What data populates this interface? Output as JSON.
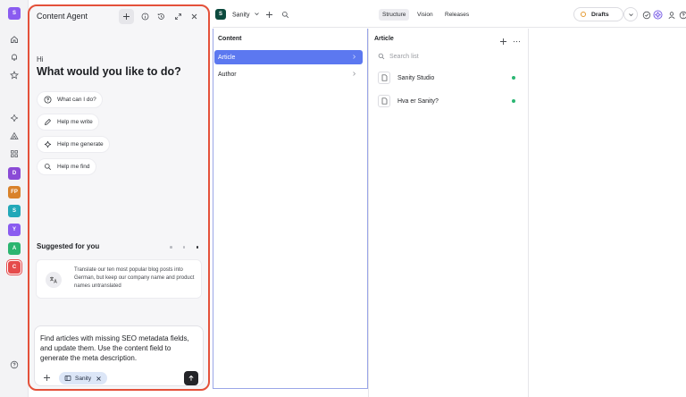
{
  "agent": {
    "title": "Content Agent",
    "greeting": "Hi",
    "headline": "What would you like to do?",
    "actions": [
      {
        "label": "What can I do?",
        "icon": "help-circle-icon"
      },
      {
        "label": "Help me write",
        "icon": "pencil-icon"
      },
      {
        "label": "Help me generate",
        "icon": "sparkle-icon"
      },
      {
        "label": "Help me find",
        "icon": "search-icon"
      }
    ],
    "suggested_title": "Suggested for you",
    "suggestion": "Translate our ten most popular blog posts into German, but keep our company name and product names untranslated",
    "input_text": "Find articles with missing SEO metadata fields, and update them. Use the content field to generate the meta description.",
    "context_pill": "Sanity"
  },
  "rail": {
    "workspace_initial": "S",
    "workspaces": [
      {
        "label": "D",
        "color": "#8a4bd6"
      },
      {
        "label": "FP",
        "color": "#d9822b"
      },
      {
        "label": "S",
        "color": "#23a8b8"
      },
      {
        "label": "Y",
        "color": "#8a5cf0"
      },
      {
        "label": "A",
        "color": "#2cb570"
      },
      {
        "label": "C",
        "color": "#e54b4b"
      }
    ]
  },
  "topbar": {
    "project_initial": "S",
    "project": "Sanity",
    "tools": [
      "Structure",
      "Vision",
      "Releases"
    ],
    "active_tool": "Structure",
    "perspective": "Drafts"
  },
  "content_pane": {
    "title": "Content",
    "items": [
      "Article",
      "Author"
    ]
  },
  "article_pane": {
    "title": "Article",
    "search_placeholder": "Search list",
    "docs": [
      "Sanity Studio",
      "Hva er Sanity?"
    ]
  },
  "colors": {
    "highlight_border": "#e4513a",
    "selected_row": "#5c78f0",
    "published_dot": "#2bb673"
  }
}
